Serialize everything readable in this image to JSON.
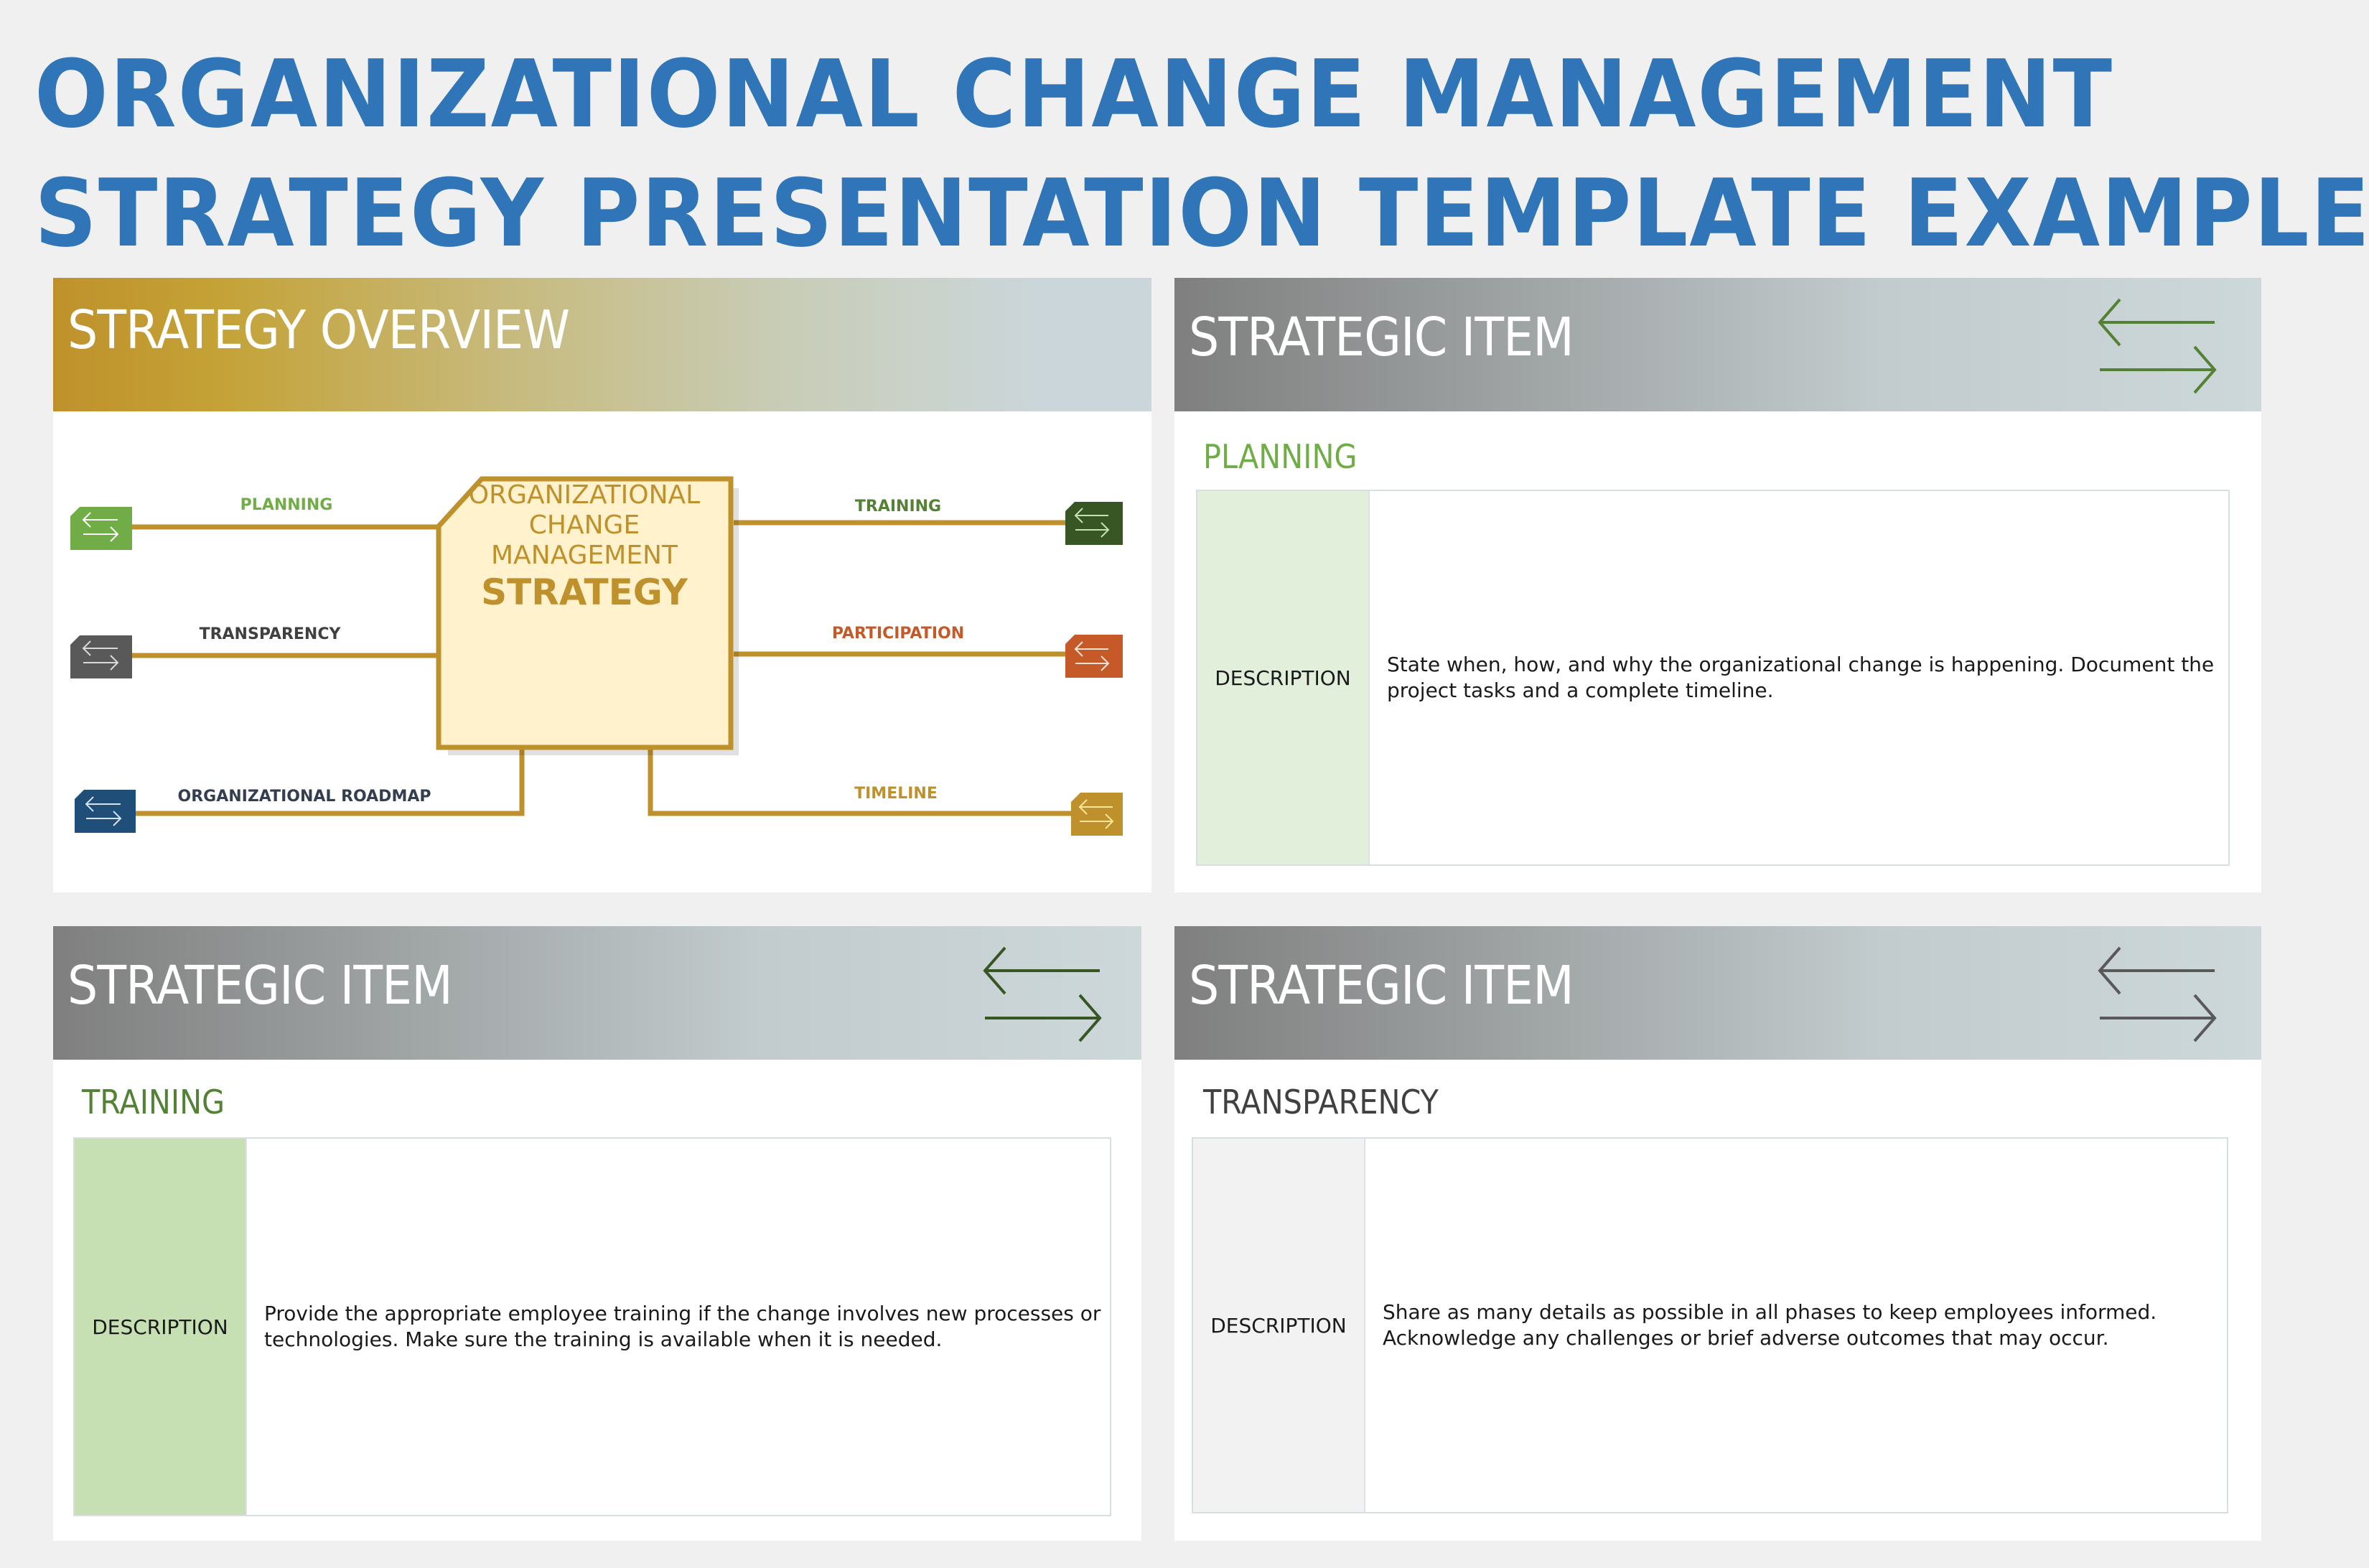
{
  "title": {
    "line1": "ORGANIZATIONAL CHANGE MANAGEMENT",
    "line2": "STRATEGY PRESENTATION TEMPLATE EXAMPLE"
  },
  "overview": {
    "header": "STRATEGY OVERVIEW",
    "center": {
      "line1": "ORGANIZATIONAL",
      "line2": "CHANGE",
      "line3": "MANAGEMENT",
      "strong": "STRATEGY"
    },
    "nodes": [
      {
        "label": "PLANNING",
        "color": "#70ad47",
        "label_color": "#70ad47",
        "icon": "swap-arrows-icon"
      },
      {
        "label": "TRANSPARENCY",
        "color": "#595959",
        "label_color": "#404040",
        "icon": "swap-arrows-icon"
      },
      {
        "label": "ORGANIZATIONAL ROADMAP",
        "color": "#1f4e79",
        "label_color": "#333f50",
        "icon": "swap-arrows-icon"
      },
      {
        "label": "TRAINING",
        "color": "#375623",
        "label_color": "#548235",
        "icon": "swap-arrows-icon"
      },
      {
        "label": "PARTICIPATION",
        "color": "#c55a28",
        "label_color": "#c55a28",
        "icon": "swap-arrows-icon"
      },
      {
        "label": "TIMELINE",
        "color": "#bf912c",
        "label_color": "#bf912c",
        "icon": "swap-arrows-icon"
      }
    ],
    "connector_color": "#bf912c",
    "center_fill": "#fff2cc"
  },
  "items": [
    {
      "header": "STRATEGIC ITEM",
      "section": "PLANNING",
      "section_color": "#70ad47",
      "arrow_color": "#548235",
      "desc_label": "DESCRIPTION",
      "desc_label_bg": "#e2efda",
      "description": "State when, how, and why the organizational change is happening. Document the project tasks and a complete timeline."
    },
    {
      "header": "STRATEGIC ITEM",
      "section": "TRAINING",
      "section_color": "#548235",
      "arrow_color": "#375623",
      "desc_label": "DESCRIPTION",
      "desc_label_bg": "#c6e0b4",
      "description": "Provide the appropriate employee training if the change involves new processes or technologies. Make sure the training is available when it is needed."
    },
    {
      "header": "STRATEGIC ITEM",
      "section": "TRANSPARENCY",
      "section_color": "#404040",
      "arrow_color": "#595959",
      "desc_label": "DESCRIPTION",
      "desc_label_bg": "#f2f2f2",
      "description": "Share as many details as possible in all phases to keep employees informed. Acknowledge any challenges or brief adverse outcomes that may occur."
    }
  ]
}
